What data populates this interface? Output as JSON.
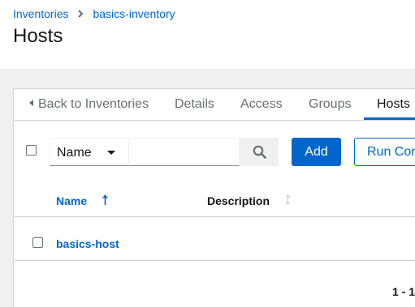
{
  "breadcrumb": {
    "items": [
      "Inventories",
      "basics-inventory"
    ]
  },
  "page": {
    "title": "Hosts"
  },
  "tabs": {
    "back": "Back to Inventories",
    "details": "Details",
    "access": "Access",
    "groups": "Groups",
    "hosts": "Hosts",
    "active": "Hosts"
  },
  "toolbar": {
    "filter_field": "Name",
    "search_placeholder": "",
    "add_label": "Add",
    "run_label": "Run Command"
  },
  "table": {
    "columns": [
      "Name",
      "Description"
    ],
    "sorted_column": "Name",
    "sort_direction": "ascending",
    "rows": [
      {
        "name": "basics-host",
        "description": ""
      }
    ]
  },
  "pagination": {
    "range": "1 - 1"
  },
  "colors": {
    "link": "#0066cc",
    "primary_button": "#0066cc",
    "page_background": "#f0f0f0"
  }
}
